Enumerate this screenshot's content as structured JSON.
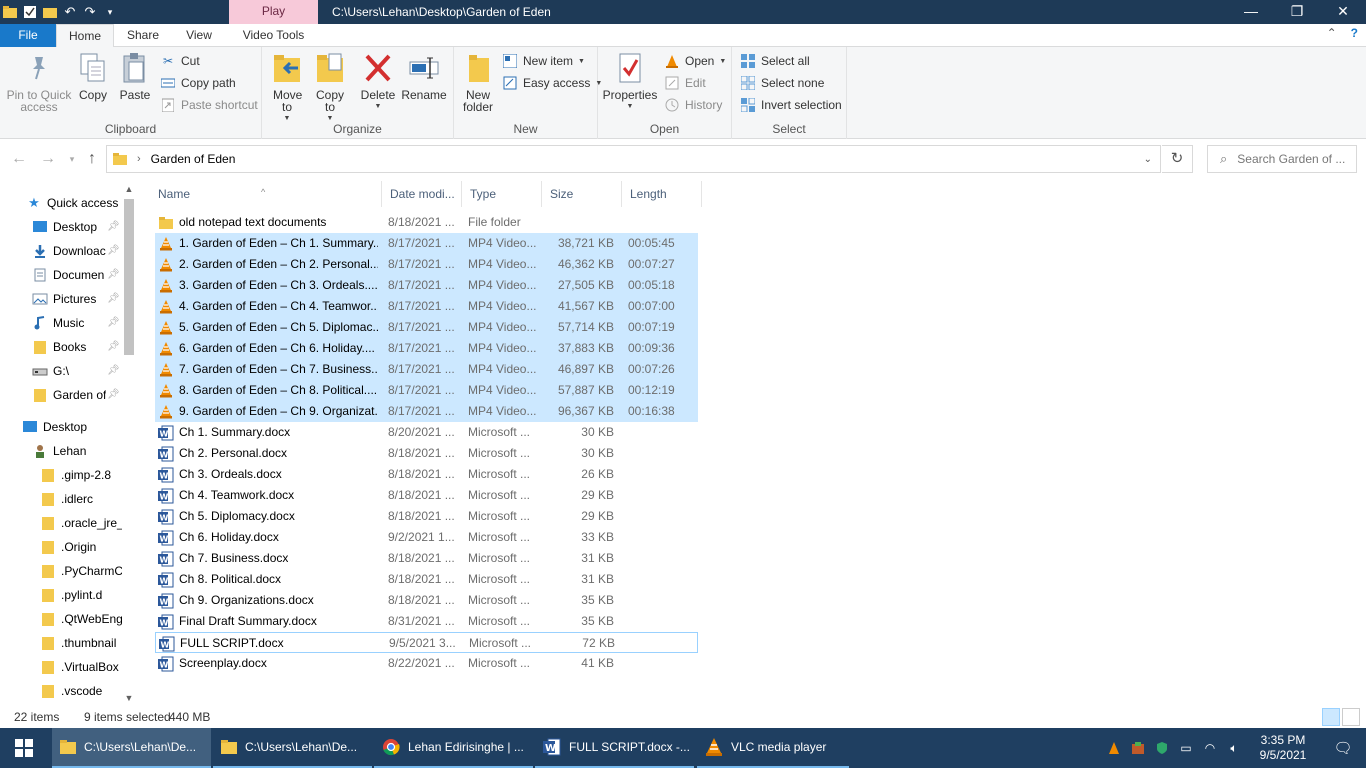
{
  "window": {
    "title": "C:\\Users\\Lehan\\Desktop\\Garden of Eden",
    "contextual_tab_header": "Play"
  },
  "ribbon_tabs": [
    "File",
    "Home",
    "Share",
    "View",
    "Video Tools"
  ],
  "ribbon": {
    "clipboard": {
      "label": "Clipboard",
      "pin": "Pin to Quick access",
      "copy": "Copy",
      "paste": "Paste",
      "cut": "Cut",
      "copy_path": "Copy path",
      "paste_shortcut": "Paste shortcut"
    },
    "organize": {
      "label": "Organize",
      "move_to": "Move to",
      "copy_to": "Copy to",
      "delete": "Delete",
      "rename": "Rename"
    },
    "new": {
      "label": "New",
      "new_folder": "New folder",
      "new_item": "New item",
      "easy_access": "Easy access"
    },
    "open": {
      "label": "Open",
      "properties": "Properties",
      "open": "Open",
      "edit": "Edit",
      "history": "History"
    },
    "select": {
      "label": "Select",
      "select_all": "Select all",
      "select_none": "Select none",
      "invert": "Invert selection"
    }
  },
  "address": {
    "crumb": "Garden of Eden",
    "search_placeholder": "Search Garden of ..."
  },
  "nav": {
    "quick_access": "Quick access",
    "items": [
      {
        "label": "Desktop",
        "pinned": true
      },
      {
        "label": "Downloac",
        "pinned": true
      },
      {
        "label": "Documen",
        "pinned": true
      },
      {
        "label": "Pictures",
        "pinned": true
      },
      {
        "label": "Music",
        "pinned": true
      },
      {
        "label": "Books",
        "pinned": true
      },
      {
        "label": "G:\\",
        "pinned": true
      },
      {
        "label": "Garden of",
        "pinned": true
      }
    ],
    "desktop": "Desktop",
    "user": "Lehan",
    "user_folders": [
      ".gimp-2.8",
      ".idlerc",
      ".oracle_jre_",
      ".Origin",
      ".PyCharmC",
      ".pylint.d",
      ".QtWebEng",
      ".thumbnail",
      ".VirtualBox",
      ".vscode"
    ]
  },
  "columns": [
    "Name",
    "Date modi...",
    "Type",
    "Size",
    "Length"
  ],
  "files": [
    {
      "name": "old notepad text documents",
      "date": "8/18/2021 ...",
      "type": "File folder",
      "size": "",
      "length": "",
      "kind": "folder",
      "selected": false
    },
    {
      "name": "1. Garden of Eden – Ch 1. Summary....",
      "date": "8/17/2021 ...",
      "type": "MP4 Video...",
      "size": "38,721 KB",
      "length": "00:05:45",
      "kind": "vlc",
      "selected": true
    },
    {
      "name": "2. Garden of Eden – Ch 2. Personal....",
      "date": "8/17/2021 ...",
      "type": "MP4 Video...",
      "size": "46,362 KB",
      "length": "00:07:27",
      "kind": "vlc",
      "selected": true
    },
    {
      "name": "3. Garden of Eden – Ch 3. Ordeals....",
      "date": "8/17/2021 ...",
      "type": "MP4 Video...",
      "size": "27,505 KB",
      "length": "00:05:18",
      "kind": "vlc",
      "selected": true
    },
    {
      "name": "4. Garden of Eden – Ch 4. Teamwor....",
      "date": "8/17/2021 ...",
      "type": "MP4 Video...",
      "size": "41,567 KB",
      "length": "00:07:00",
      "kind": "vlc",
      "selected": true
    },
    {
      "name": "5. Garden of Eden – Ch 5. Diplomac....",
      "date": "8/17/2021 ...",
      "type": "MP4 Video...",
      "size": "57,714 KB",
      "length": "00:07:19",
      "kind": "vlc",
      "selected": true
    },
    {
      "name": "6. Garden of Eden – Ch 6. Holiday....",
      "date": "8/17/2021 ...",
      "type": "MP4 Video...",
      "size": "37,883 KB",
      "length": "00:09:36",
      "kind": "vlc",
      "selected": true
    },
    {
      "name": "7. Garden of Eden – Ch 7. Business....",
      "date": "8/17/2021 ...",
      "type": "MP4 Video...",
      "size": "46,897 KB",
      "length": "00:07:26",
      "kind": "vlc",
      "selected": true
    },
    {
      "name": "8. Garden of Eden – Ch 8. Political....",
      "date": "8/17/2021 ...",
      "type": "MP4 Video...",
      "size": "57,887 KB",
      "length": "00:12:19",
      "kind": "vlc",
      "selected": true
    },
    {
      "name": "9. Garden of Eden – Ch 9. Organizat...",
      "date": "8/17/2021 ...",
      "type": "MP4 Video...",
      "size": "96,367 KB",
      "length": "00:16:38",
      "kind": "vlc",
      "selected": true
    },
    {
      "name": "Ch 1. Summary.docx",
      "date": "8/20/2021 ...",
      "type": "Microsoft ...",
      "size": "30 KB",
      "length": "",
      "kind": "word",
      "selected": false
    },
    {
      "name": "Ch 2. Personal.docx",
      "date": "8/18/2021 ...",
      "type": "Microsoft ...",
      "size": "30 KB",
      "length": "",
      "kind": "word",
      "selected": false
    },
    {
      "name": "Ch 3. Ordeals.docx",
      "date": "8/18/2021 ...",
      "type": "Microsoft ...",
      "size": "26 KB",
      "length": "",
      "kind": "word",
      "selected": false
    },
    {
      "name": "Ch 4. Teamwork.docx",
      "date": "8/18/2021 ...",
      "type": "Microsoft ...",
      "size": "29 KB",
      "length": "",
      "kind": "word",
      "selected": false
    },
    {
      "name": "Ch 5. Diplomacy.docx",
      "date": "8/18/2021 ...",
      "type": "Microsoft ...",
      "size": "29 KB",
      "length": "",
      "kind": "word",
      "selected": false
    },
    {
      "name": "Ch 6. Holiday.docx",
      "date": "9/2/2021 1...",
      "type": "Microsoft ...",
      "size": "33 KB",
      "length": "",
      "kind": "word",
      "selected": false
    },
    {
      "name": "Ch 7. Business.docx",
      "date": "8/18/2021 ...",
      "type": "Microsoft ...",
      "size": "31 KB",
      "length": "",
      "kind": "word",
      "selected": false
    },
    {
      "name": "Ch 8. Political.docx",
      "date": "8/18/2021 ...",
      "type": "Microsoft ...",
      "size": "31 KB",
      "length": "",
      "kind": "word",
      "selected": false
    },
    {
      "name": "Ch 9. Organizations.docx",
      "date": "8/18/2021 ...",
      "type": "Microsoft ...",
      "size": "35 KB",
      "length": "",
      "kind": "word",
      "selected": false
    },
    {
      "name": "Final Draft Summary.docx",
      "date": "8/31/2021 ...",
      "type": "Microsoft ...",
      "size": "35 KB",
      "length": "",
      "kind": "word",
      "selected": false
    },
    {
      "name": "FULL SCRIPT.docx",
      "date": "9/5/2021 3...",
      "type": "Microsoft ...",
      "size": "72 KB",
      "length": "",
      "kind": "word",
      "selected": false,
      "focused": true
    },
    {
      "name": "Screenplay.docx",
      "date": "8/22/2021 ...",
      "type": "Microsoft ...",
      "size": "41 KB",
      "length": "",
      "kind": "word",
      "selected": false
    }
  ],
  "status": {
    "count": "22 items",
    "selected": "9 items selected",
    "size": "440 MB"
  },
  "taskbar": {
    "items": [
      {
        "label": "C:\\Users\\Lehan\\De...",
        "icon": "folder-icon",
        "active": true
      },
      {
        "label": "C:\\Users\\Lehan\\De...",
        "icon": "folder-icon",
        "active": false
      },
      {
        "label": "Lehan Edirisinghe | ...",
        "icon": "chrome-icon",
        "active": false
      },
      {
        "label": "FULL SCRIPT.docx -...",
        "icon": "word-icon",
        "active": false
      },
      {
        "label": "VLC media player",
        "icon": "vlc-icon",
        "active": false
      }
    ],
    "time": "3:35 PM",
    "date": "9/5/2021"
  },
  "colors": {
    "titlebar": "#1e3a57",
    "accent": "#1979ca",
    "selection": "#cce8ff",
    "taskbar": "#1f3f61"
  }
}
